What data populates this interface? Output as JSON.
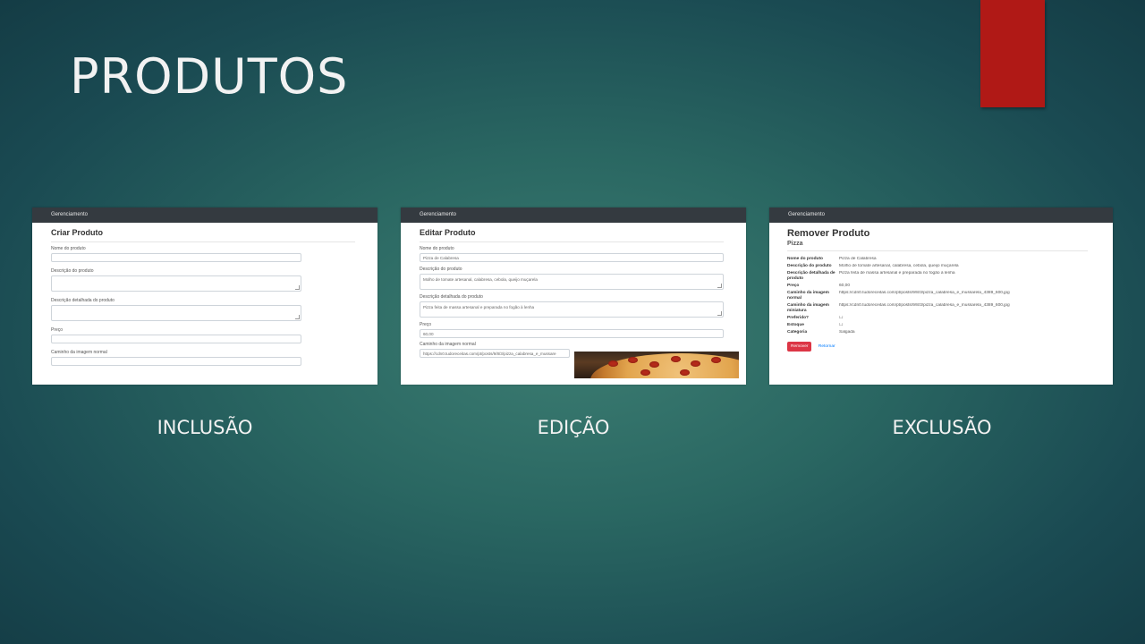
{
  "slide": {
    "title": "PRODUTOS",
    "accent_color": "#b01916"
  },
  "captions": {
    "create": "INCLUSÃO",
    "edit": "EDIÇÃO",
    "delete": "EXCLUSÃO"
  },
  "create_screen": {
    "navbar": "Gerenciamento",
    "heading": "Criar Produto",
    "fields": {
      "name_label": "Nome do produto",
      "description_label": "Descrição do produto",
      "detailed_description_label": "Descrição detalhada do produto",
      "price_label": "Preço",
      "image_path_label": "Caminho da imagem normal"
    }
  },
  "edit_screen": {
    "navbar": "Gerenciamento",
    "heading": "Editar Produto",
    "fields": {
      "name_label": "Nome do produto",
      "name_value": "Pizza de Calabresa",
      "description_label": "Descrição do produto",
      "description_value": "Molho de tomate artesanal, calabresa, cebola, queijo muçarela",
      "detailed_description_label": "Descrição detalhada do produto",
      "detailed_description_value": "Pizza feita de massa artesanal e preparada no fogão à lenha",
      "price_label": "Preço",
      "price_value": "60,00",
      "image_path_label": "Caminho da imagem normal",
      "image_path_value": "https://cdn0.tudoreceitas.com/pt/posts/9/8/3/pizza_calabresa_e_mussare"
    }
  },
  "delete_screen": {
    "navbar": "Gerenciamento",
    "heading": "Remover Produto",
    "subheading": "Pizza",
    "details": [
      {
        "label": "Nome do produto",
        "value": "Pizza de Calabresa"
      },
      {
        "label": "Descrição do produto",
        "value": "Molho de tomate artesanal, calabresa, cebola, queijo muçarela"
      },
      {
        "label": "Descrição detalhada de produto",
        "value": "Pizza feita de massa artesanal e preparada no fogão à lenha"
      },
      {
        "label": "Preço",
        "value": "60,00"
      },
      {
        "label": "Caminho da imagem normal",
        "value": "https://cdn0.tudoreceitas.com/pt/posts/9/8/3/pizza_calabresa_e_mussarela_4389_600.jpg"
      },
      {
        "label": "Caminho da imagem miniatura",
        "value": "https://cdn0.tudoreceitas.com/pt/posts/9/8/3/pizza_calabresa_e_mussarela_4389_600.jpg"
      },
      {
        "label": "Preferido?",
        "value": "☐"
      },
      {
        "label": "Estoque",
        "value": "☐"
      },
      {
        "label": "Categoria",
        "value": "Salgada"
      }
    ],
    "remove_button": "Remover",
    "return_link": "Retornar"
  }
}
